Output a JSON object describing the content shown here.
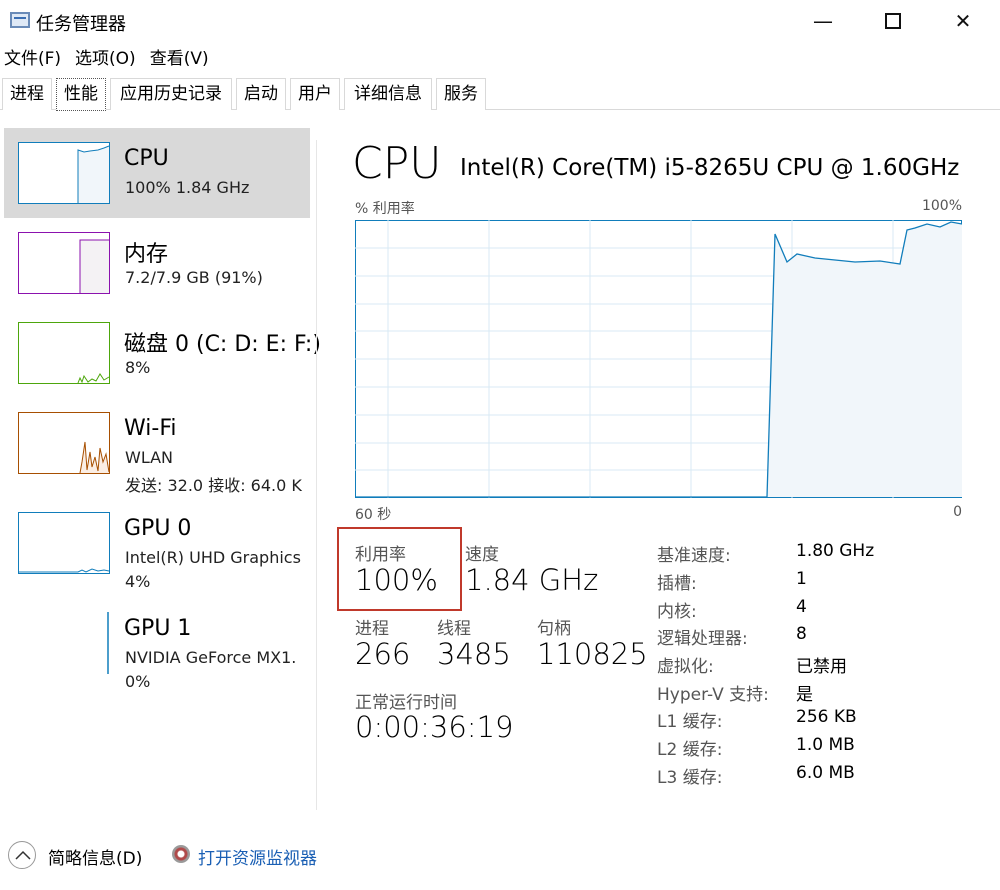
{
  "window": {
    "title": "任务管理器",
    "min_glyph": "—",
    "close_glyph": "✕"
  },
  "menu": [
    "文件(F)",
    "选项(O)",
    "查看(V)"
  ],
  "tabs": [
    "进程",
    "性能",
    "应用历史记录",
    "启动",
    "用户",
    "详细信息",
    "服务"
  ],
  "active_tab": "性能",
  "sidebar": {
    "items": [
      {
        "name": "CPU",
        "line1": "100%  1.84 GHz",
        "line2": "",
        "color": "#117dbb"
      },
      {
        "name": "内存",
        "line1": "7.2/7.9 GB (91%)",
        "line2": "",
        "color": "#8b12ae"
      },
      {
        "name": "磁盘 0 (C: D: E: F:)",
        "line1": "8%",
        "line2": "",
        "color": "#4da60c"
      },
      {
        "name": "Wi-Fi",
        "line1": "WLAN",
        "line2": "发送: 32.0  接收: 64.0 K",
        "color": "#a74f01"
      },
      {
        "name": "GPU 0",
        "line1": "Intel(R) UHD Graphics",
        "line2": "4%",
        "color": "#117dbb"
      },
      {
        "name": "GPU 1",
        "line1": "NVIDIA GeForce MX1.",
        "line2": "0%",
        "color": "#117dbb"
      }
    ]
  },
  "main": {
    "title": "CPU",
    "model": "Intel(R) Core(TM) i5-8265U CPU @ 1.60GHz",
    "graph": {
      "y_label": "% 利用率",
      "y_max_label": "100%",
      "x_left_label": "60 秒",
      "x_right_label": "0",
      "line_color": "#117dbb",
      "fill_color": "#f1f6fa",
      "grid_color": "#d9eaf4"
    },
    "stats": {
      "utilization_label": "利用率",
      "utilization_value": "100%",
      "speed_label": "速度",
      "speed_value": "1.84 GHz",
      "processes_label": "进程",
      "processes_value": "266",
      "threads_label": "线程",
      "threads_value": "3485",
      "handles_label": "句柄",
      "handles_value": "110825",
      "uptime_label": "正常运行时间",
      "uptime_value": "0:00:36:19"
    },
    "specs": [
      {
        "label": "基准速度:",
        "value": "1.80 GHz"
      },
      {
        "label": "插槽:",
        "value": "1"
      },
      {
        "label": "内核:",
        "value": "4"
      },
      {
        "label": "逻辑处理器:",
        "value": "8"
      },
      {
        "label": "虚拟化:",
        "value": "已禁用"
      },
      {
        "label": "Hyper-V 支持:",
        "value": "是"
      },
      {
        "label": "L1 缓存:",
        "value": "256 KB"
      },
      {
        "label": "L2 缓存:",
        "value": "1.0 MB"
      },
      {
        "label": "L3 缓存:",
        "value": "6.0 MB"
      }
    ]
  },
  "footer": {
    "brief_label": "简略信息(D)",
    "monitor_link": "打开资源监视器"
  }
}
